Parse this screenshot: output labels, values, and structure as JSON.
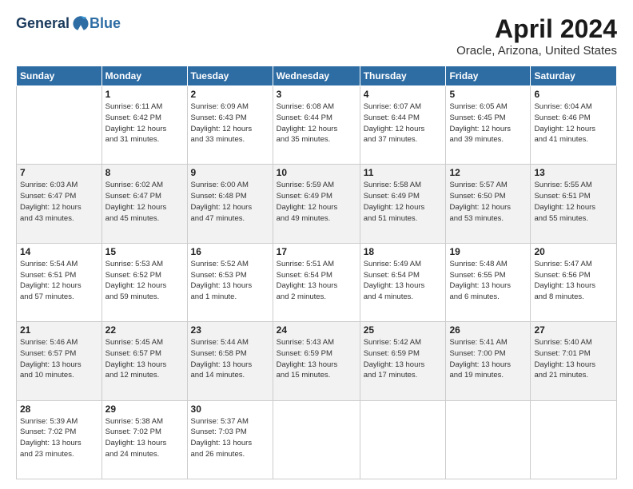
{
  "header": {
    "logo_general": "General",
    "logo_blue": "Blue",
    "main_title": "April 2024",
    "subtitle": "Oracle, Arizona, United States"
  },
  "calendar": {
    "columns": [
      "Sunday",
      "Monday",
      "Tuesday",
      "Wednesday",
      "Thursday",
      "Friday",
      "Saturday"
    ],
    "rows": [
      [
        {
          "num": "",
          "info": ""
        },
        {
          "num": "1",
          "info": "Sunrise: 6:11 AM\nSunset: 6:42 PM\nDaylight: 12 hours\nand 31 minutes."
        },
        {
          "num": "2",
          "info": "Sunrise: 6:09 AM\nSunset: 6:43 PM\nDaylight: 12 hours\nand 33 minutes."
        },
        {
          "num": "3",
          "info": "Sunrise: 6:08 AM\nSunset: 6:44 PM\nDaylight: 12 hours\nand 35 minutes."
        },
        {
          "num": "4",
          "info": "Sunrise: 6:07 AM\nSunset: 6:44 PM\nDaylight: 12 hours\nand 37 minutes."
        },
        {
          "num": "5",
          "info": "Sunrise: 6:05 AM\nSunset: 6:45 PM\nDaylight: 12 hours\nand 39 minutes."
        },
        {
          "num": "6",
          "info": "Sunrise: 6:04 AM\nSunset: 6:46 PM\nDaylight: 12 hours\nand 41 minutes."
        }
      ],
      [
        {
          "num": "7",
          "info": "Sunrise: 6:03 AM\nSunset: 6:47 PM\nDaylight: 12 hours\nand 43 minutes."
        },
        {
          "num": "8",
          "info": "Sunrise: 6:02 AM\nSunset: 6:47 PM\nDaylight: 12 hours\nand 45 minutes."
        },
        {
          "num": "9",
          "info": "Sunrise: 6:00 AM\nSunset: 6:48 PM\nDaylight: 12 hours\nand 47 minutes."
        },
        {
          "num": "10",
          "info": "Sunrise: 5:59 AM\nSunset: 6:49 PM\nDaylight: 12 hours\nand 49 minutes."
        },
        {
          "num": "11",
          "info": "Sunrise: 5:58 AM\nSunset: 6:49 PM\nDaylight: 12 hours\nand 51 minutes."
        },
        {
          "num": "12",
          "info": "Sunrise: 5:57 AM\nSunset: 6:50 PM\nDaylight: 12 hours\nand 53 minutes."
        },
        {
          "num": "13",
          "info": "Sunrise: 5:55 AM\nSunset: 6:51 PM\nDaylight: 12 hours\nand 55 minutes."
        }
      ],
      [
        {
          "num": "14",
          "info": "Sunrise: 5:54 AM\nSunset: 6:51 PM\nDaylight: 12 hours\nand 57 minutes."
        },
        {
          "num": "15",
          "info": "Sunrise: 5:53 AM\nSunset: 6:52 PM\nDaylight: 12 hours\nand 59 minutes."
        },
        {
          "num": "16",
          "info": "Sunrise: 5:52 AM\nSunset: 6:53 PM\nDaylight: 13 hours\nand 1 minute."
        },
        {
          "num": "17",
          "info": "Sunrise: 5:51 AM\nSunset: 6:54 PM\nDaylight: 13 hours\nand 2 minutes."
        },
        {
          "num": "18",
          "info": "Sunrise: 5:49 AM\nSunset: 6:54 PM\nDaylight: 13 hours\nand 4 minutes."
        },
        {
          "num": "19",
          "info": "Sunrise: 5:48 AM\nSunset: 6:55 PM\nDaylight: 13 hours\nand 6 minutes."
        },
        {
          "num": "20",
          "info": "Sunrise: 5:47 AM\nSunset: 6:56 PM\nDaylight: 13 hours\nand 8 minutes."
        }
      ],
      [
        {
          "num": "21",
          "info": "Sunrise: 5:46 AM\nSunset: 6:57 PM\nDaylight: 13 hours\nand 10 minutes."
        },
        {
          "num": "22",
          "info": "Sunrise: 5:45 AM\nSunset: 6:57 PM\nDaylight: 13 hours\nand 12 minutes."
        },
        {
          "num": "23",
          "info": "Sunrise: 5:44 AM\nSunset: 6:58 PM\nDaylight: 13 hours\nand 14 minutes."
        },
        {
          "num": "24",
          "info": "Sunrise: 5:43 AM\nSunset: 6:59 PM\nDaylight: 13 hours\nand 15 minutes."
        },
        {
          "num": "25",
          "info": "Sunrise: 5:42 AM\nSunset: 6:59 PM\nDaylight: 13 hours\nand 17 minutes."
        },
        {
          "num": "26",
          "info": "Sunrise: 5:41 AM\nSunset: 7:00 PM\nDaylight: 13 hours\nand 19 minutes."
        },
        {
          "num": "27",
          "info": "Sunrise: 5:40 AM\nSunset: 7:01 PM\nDaylight: 13 hours\nand 21 minutes."
        }
      ],
      [
        {
          "num": "28",
          "info": "Sunrise: 5:39 AM\nSunset: 7:02 PM\nDaylight: 13 hours\nand 23 minutes."
        },
        {
          "num": "29",
          "info": "Sunrise: 5:38 AM\nSunset: 7:02 PM\nDaylight: 13 hours\nand 24 minutes."
        },
        {
          "num": "30",
          "info": "Sunrise: 5:37 AM\nSunset: 7:03 PM\nDaylight: 13 hours\nand 26 minutes."
        },
        {
          "num": "",
          "info": ""
        },
        {
          "num": "",
          "info": ""
        },
        {
          "num": "",
          "info": ""
        },
        {
          "num": "",
          "info": ""
        }
      ]
    ]
  }
}
